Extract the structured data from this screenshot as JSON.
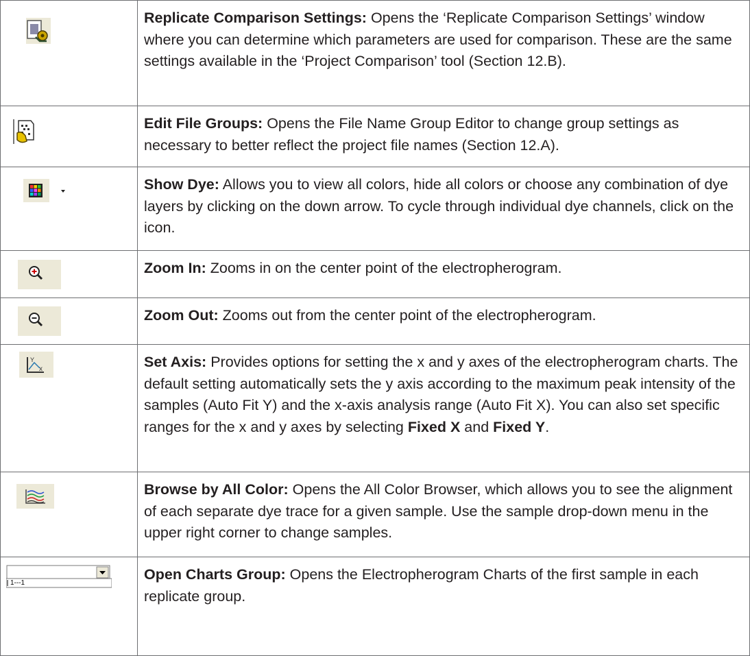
{
  "rows": [
    {
      "icon": "replicate-settings-icon",
      "title": "Replicate Comparison Settings:",
      "text": "Opens the ‘Replicate Comparison Settings’ window where you can determine which parameters are used for comparison. These are the same settings available in the ‘Project Comparison’ tool (Section 12.B)."
    },
    {
      "icon": "edit-file-groups-icon",
      "title": "Edit File Groups:",
      "text": "Opens the File Name Group Editor to change group settings as necessary to better reflect the project file names (Section 12.A)."
    },
    {
      "icon": "show-dye-icon",
      "title": "Show Dye:",
      "text": "Allows you to view all colors, hide all colors or choose any combination of dye layers by clicking on the down arrow. To cycle through individual dye channels, click on the icon."
    },
    {
      "icon": "zoom-in-icon",
      "title": "Zoom In:",
      "text": "Zooms in on the center point of the electropherogram."
    },
    {
      "icon": "zoom-out-icon",
      "title": "Zoom Out:",
      "text": "Zooms out from the center point of the electropherogram."
    },
    {
      "icon": "set-axis-icon",
      "title": "Set Axis:",
      "text_before": "Provides options for setting the x and y axes of the electropherogram charts. The default setting automatically sets the y axis according to the maximum peak intensity of the samples (Auto Fit Y) and the x-axis analysis range (Auto Fit X). You can also set specific ranges for the x and y axes by selecting",
      "bold1": "Fixed X",
      "and": "and",
      "bold2": "Fixed Y",
      "end": "."
    },
    {
      "icon": "all-color-browser-icon",
      "title": "Browse by All Color:",
      "text": "Opens the All Color Browser, which allows you to see the alignment of each separate dye trace for a given sample. Use the sample drop-down menu in the upper right corner to change samples."
    },
    {
      "icon": "charts-group-dropdown-icon",
      "title": "Open Charts Group:",
      "text": "Opens the Electropherogram Charts of the first sample in each replicate group.",
      "dropdown_value": "1---1"
    }
  ]
}
